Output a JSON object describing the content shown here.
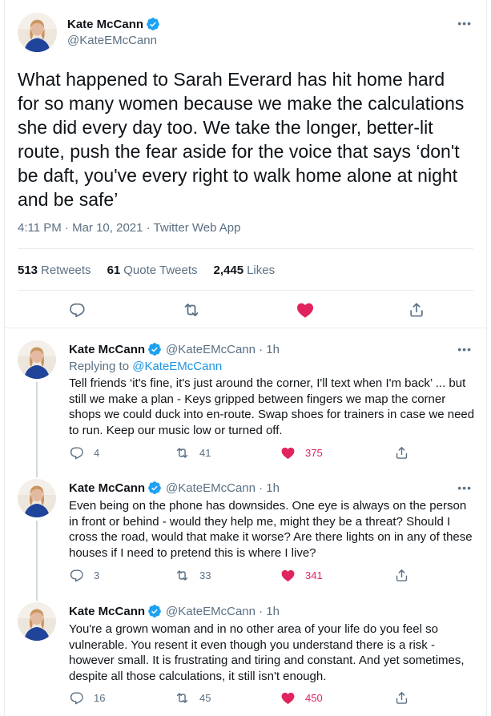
{
  "colors": {
    "accent": "#1da1f2",
    "like": "#e0245e",
    "muted": "#5b7083",
    "text": "#0f1419"
  },
  "main_tweet": {
    "author_name": "Kate McCann",
    "handle": "@KateEMcCann",
    "more_label": "•••",
    "text": "What happened to Sarah Everard has hit home hard for so many women because we make the calculations she did every day too. We take the longer, better-lit route, push the fear aside for the voice that says ‘don't be daft, you've every right to walk home alone at night and be safe’",
    "meta": "4:11 PM · Mar 10, 2021 · Twitter Web App",
    "stats": {
      "retweets_count": "513",
      "retweets_label": "Retweets",
      "quotes_count": "61",
      "quotes_label": "Quote Tweets",
      "likes_count": "2,445",
      "likes_label": "Likes"
    }
  },
  "replies": [
    {
      "author_name": "Kate McCann",
      "handle_time": "@KateEMcCann · 1h",
      "replying_prefix": "Replying to ",
      "replying_handle": "@KateEMcCann",
      "text": "Tell friends ‘it's fine, it's just around the corner, I'll text when I'm back’ ... but still we make a plan - Keys gripped between fingers we map the corner shops we could duck into en-route. Swap shoes for trainers in case we need to run. Keep our music low or turned off.",
      "replies": "4",
      "retweets": "41",
      "likes": "375"
    },
    {
      "author_name": "Kate McCann",
      "handle_time": "@KateEMcCann · 1h",
      "text": "Even being on the phone has downsides. One eye is always on the person in front or behind - would they help me, might they be a threat? Should I cross the road, would that make it worse? Are there lights on in any of these houses if I need to pretend this is where I live?",
      "replies": "3",
      "retweets": "33",
      "likes": "341"
    },
    {
      "author_name": "Kate McCann",
      "handle_time": "@KateEMcCann · 1h",
      "text": "You're a grown woman and in no other area of your life do you feel so vulnerable. You resent it even though you understand there is a risk - however small. It is frustrating and tiring and constant. And yet sometimes, despite all those calculations, it still isn't enough.",
      "replies": "16",
      "retweets": "45",
      "likes": "450"
    }
  ],
  "icons": {
    "verified": "verified-badge-icon",
    "reply": "reply-icon",
    "retweet": "retweet-icon",
    "like": "heart-icon",
    "share": "share-icon"
  }
}
